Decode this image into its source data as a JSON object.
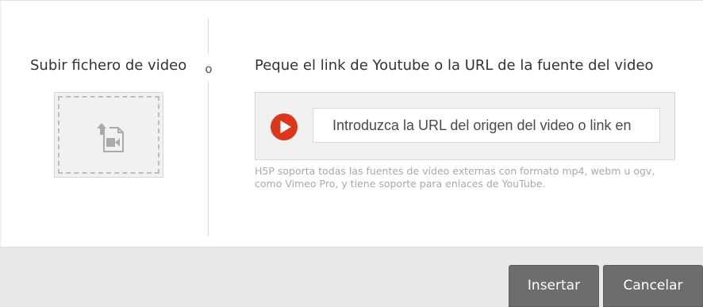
{
  "upload": {
    "title": "Subir fichero de video",
    "icon": "video-file-upload-icon"
  },
  "separator": {
    "or_label": "o"
  },
  "url_source": {
    "title": "Peque el link de Youtube o la URL de la fuente del video",
    "icon": "play-icon",
    "input_placeholder": "Introduzca la URL del origen del video o link en",
    "input_value": "",
    "help_text": "H5P soporta todas las fuentes de vídeo externas con formato mp4, webm u ogv, como Vimeo Pro, y tiene soporte para enlaces de YouTube."
  },
  "footer": {
    "insert_label": "Insertar",
    "cancel_label": "Cancelar"
  },
  "colors": {
    "play_red": "#d9381e",
    "button_gray": "#6d6d6d",
    "footer_bg": "#e9e9e9",
    "panel_bg": "#f1f1f1"
  }
}
